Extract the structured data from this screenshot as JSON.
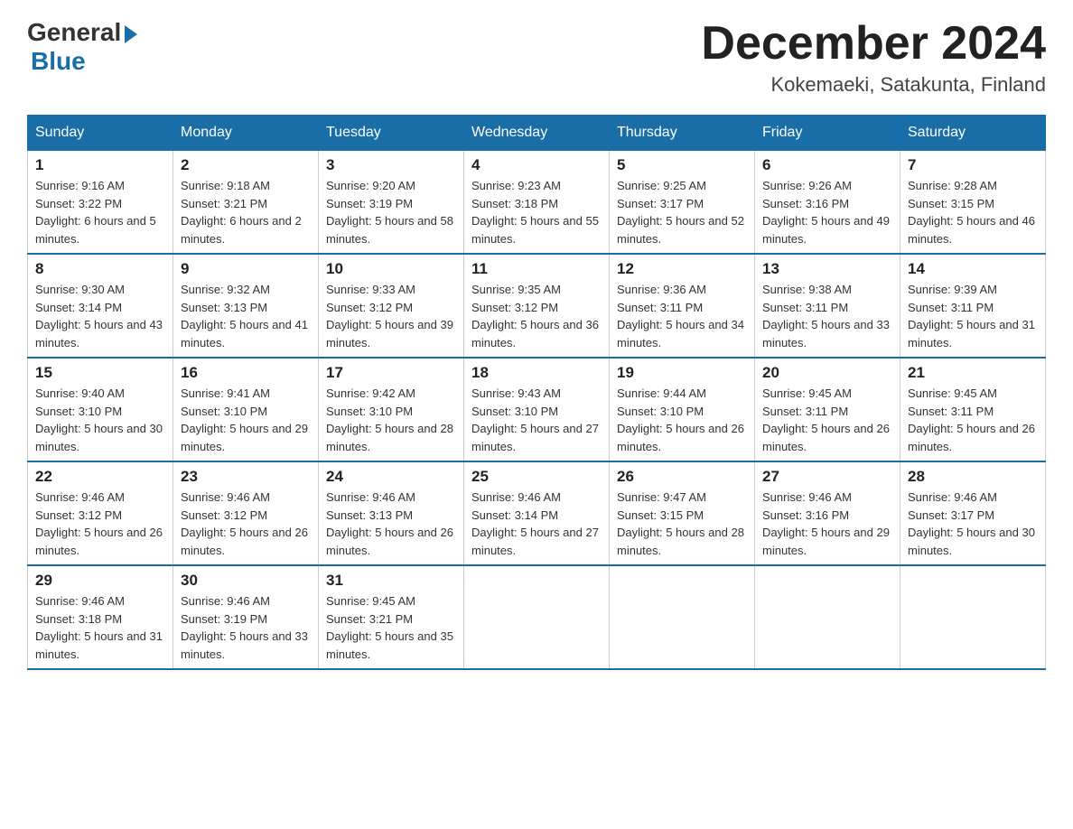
{
  "header": {
    "logo_general": "General",
    "logo_blue": "Blue",
    "month_title": "December 2024",
    "subtitle": "Kokemaeki, Satakunta, Finland"
  },
  "days_of_week": [
    "Sunday",
    "Monday",
    "Tuesday",
    "Wednesday",
    "Thursday",
    "Friday",
    "Saturday"
  ],
  "weeks": [
    [
      {
        "day": "1",
        "sunrise": "9:16 AM",
        "sunset": "3:22 PM",
        "daylight": "6 hours and 5 minutes."
      },
      {
        "day": "2",
        "sunrise": "9:18 AM",
        "sunset": "3:21 PM",
        "daylight": "6 hours and 2 minutes."
      },
      {
        "day": "3",
        "sunrise": "9:20 AM",
        "sunset": "3:19 PM",
        "daylight": "5 hours and 58 minutes."
      },
      {
        "day": "4",
        "sunrise": "9:23 AM",
        "sunset": "3:18 PM",
        "daylight": "5 hours and 55 minutes."
      },
      {
        "day": "5",
        "sunrise": "9:25 AM",
        "sunset": "3:17 PM",
        "daylight": "5 hours and 52 minutes."
      },
      {
        "day": "6",
        "sunrise": "9:26 AM",
        "sunset": "3:16 PM",
        "daylight": "5 hours and 49 minutes."
      },
      {
        "day": "7",
        "sunrise": "9:28 AM",
        "sunset": "3:15 PM",
        "daylight": "5 hours and 46 minutes."
      }
    ],
    [
      {
        "day": "8",
        "sunrise": "9:30 AM",
        "sunset": "3:14 PM",
        "daylight": "5 hours and 43 minutes."
      },
      {
        "day": "9",
        "sunrise": "9:32 AM",
        "sunset": "3:13 PM",
        "daylight": "5 hours and 41 minutes."
      },
      {
        "day": "10",
        "sunrise": "9:33 AM",
        "sunset": "3:12 PM",
        "daylight": "5 hours and 39 minutes."
      },
      {
        "day": "11",
        "sunrise": "9:35 AM",
        "sunset": "3:12 PM",
        "daylight": "5 hours and 36 minutes."
      },
      {
        "day": "12",
        "sunrise": "9:36 AM",
        "sunset": "3:11 PM",
        "daylight": "5 hours and 34 minutes."
      },
      {
        "day": "13",
        "sunrise": "9:38 AM",
        "sunset": "3:11 PM",
        "daylight": "5 hours and 33 minutes."
      },
      {
        "day": "14",
        "sunrise": "9:39 AM",
        "sunset": "3:11 PM",
        "daylight": "5 hours and 31 minutes."
      }
    ],
    [
      {
        "day": "15",
        "sunrise": "9:40 AM",
        "sunset": "3:10 PM",
        "daylight": "5 hours and 30 minutes."
      },
      {
        "day": "16",
        "sunrise": "9:41 AM",
        "sunset": "3:10 PM",
        "daylight": "5 hours and 29 minutes."
      },
      {
        "day": "17",
        "sunrise": "9:42 AM",
        "sunset": "3:10 PM",
        "daylight": "5 hours and 28 minutes."
      },
      {
        "day": "18",
        "sunrise": "9:43 AM",
        "sunset": "3:10 PM",
        "daylight": "5 hours and 27 minutes."
      },
      {
        "day": "19",
        "sunrise": "9:44 AM",
        "sunset": "3:10 PM",
        "daylight": "5 hours and 26 minutes."
      },
      {
        "day": "20",
        "sunrise": "9:45 AM",
        "sunset": "3:11 PM",
        "daylight": "5 hours and 26 minutes."
      },
      {
        "day": "21",
        "sunrise": "9:45 AM",
        "sunset": "3:11 PM",
        "daylight": "5 hours and 26 minutes."
      }
    ],
    [
      {
        "day": "22",
        "sunrise": "9:46 AM",
        "sunset": "3:12 PM",
        "daylight": "5 hours and 26 minutes."
      },
      {
        "day": "23",
        "sunrise": "9:46 AM",
        "sunset": "3:12 PM",
        "daylight": "5 hours and 26 minutes."
      },
      {
        "day": "24",
        "sunrise": "9:46 AM",
        "sunset": "3:13 PM",
        "daylight": "5 hours and 26 minutes."
      },
      {
        "day": "25",
        "sunrise": "9:46 AM",
        "sunset": "3:14 PM",
        "daylight": "5 hours and 27 minutes."
      },
      {
        "day": "26",
        "sunrise": "9:47 AM",
        "sunset": "3:15 PM",
        "daylight": "5 hours and 28 minutes."
      },
      {
        "day": "27",
        "sunrise": "9:46 AM",
        "sunset": "3:16 PM",
        "daylight": "5 hours and 29 minutes."
      },
      {
        "day": "28",
        "sunrise": "9:46 AM",
        "sunset": "3:17 PM",
        "daylight": "5 hours and 30 minutes."
      }
    ],
    [
      {
        "day": "29",
        "sunrise": "9:46 AM",
        "sunset": "3:18 PM",
        "daylight": "5 hours and 31 minutes."
      },
      {
        "day": "30",
        "sunrise": "9:46 AM",
        "sunset": "3:19 PM",
        "daylight": "5 hours and 33 minutes."
      },
      {
        "day": "31",
        "sunrise": "9:45 AM",
        "sunset": "3:21 PM",
        "daylight": "5 hours and 35 minutes."
      },
      null,
      null,
      null,
      null
    ]
  ]
}
